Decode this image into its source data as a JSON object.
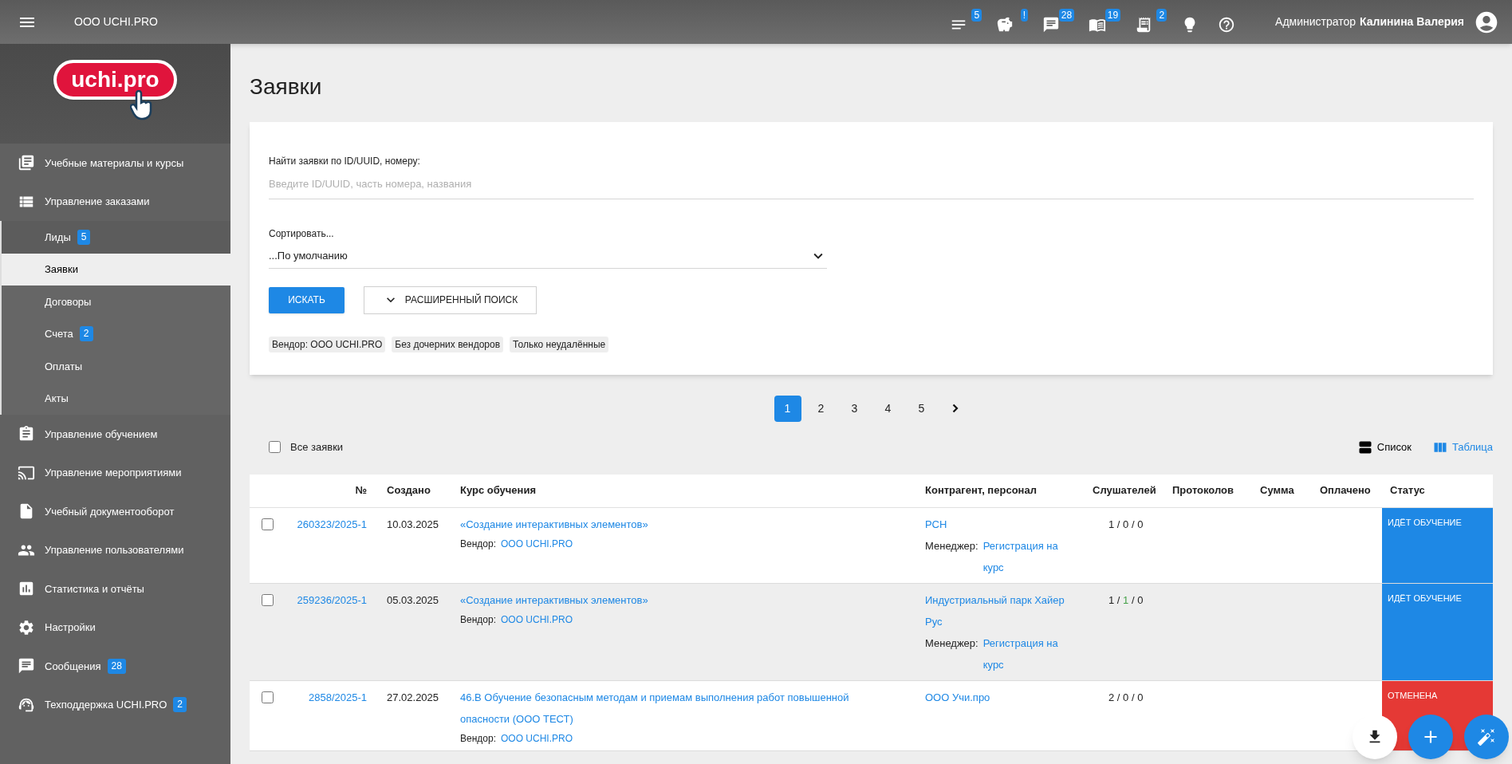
{
  "topbar": {
    "org": "ООО UCHI.PRO",
    "icons": [
      {
        "kind": "notes",
        "badge": "5"
      },
      {
        "kind": "piggy",
        "badge": "!"
      },
      {
        "kind": "chat",
        "badge": "28"
      },
      {
        "kind": "book",
        "badge": "19"
      },
      {
        "kind": "receipt",
        "badge": "2"
      },
      {
        "kind": "bulb"
      },
      {
        "kind": "help"
      }
    ],
    "user_role": "Администратор",
    "user_name": "Калинина Валерия"
  },
  "sidebar": {
    "logo": "uchi.pro",
    "items": [
      {
        "label": "Учебные материалы и курсы",
        "kind": "library",
        "selected": false
      },
      {
        "label": "Управление заказами",
        "kind": "list",
        "selected": false,
        "expanded": true,
        "children": [
          {
            "label": "Лиды",
            "badge": "5",
            "selected": false
          },
          {
            "label": "Заявки",
            "selected": true
          },
          {
            "label": "Договоры",
            "selected": false
          },
          {
            "label": "Счета",
            "badge": "2",
            "selected": false
          },
          {
            "label": "Оплаты",
            "selected": false
          },
          {
            "label": "Акты",
            "selected": false
          }
        ]
      },
      {
        "label": "Управление обучением",
        "kind": "clipboard",
        "selected": false
      },
      {
        "label": "Управление мероприятиями",
        "kind": "cast",
        "selected": false
      },
      {
        "label": "Учебный документооборот",
        "kind": "file",
        "selected": false
      },
      {
        "label": "Управление пользователями",
        "kind": "people",
        "selected": false
      },
      {
        "label": "Статистика и отчёты",
        "kind": "stats",
        "selected": false
      },
      {
        "label": "Настройки",
        "kind": "settings",
        "selected": false
      },
      {
        "label": "Сообщения",
        "kind": "chat",
        "badge": "28",
        "selected": false
      },
      {
        "label": "Техподдержка UCHI.PRO",
        "kind": "support",
        "badge": "2",
        "selected": false
      }
    ]
  },
  "page_title": "Заявки",
  "filter": {
    "search_label": "Найти заявки по ID/UUID, номеру:",
    "search_placeholder": "Введите ID/UUID, часть номера, названия",
    "sort_label": "Сортировать...",
    "sort_value": "...По умолчанию",
    "search_button": "ИСКАТЬ",
    "advanced_button": "РАСШИРЕННЫЙ ПОИСК",
    "chips": [
      "Вендор: ООО UCHI.PRO",
      "Без дочерних вендоров",
      "Только неудалённые"
    ]
  },
  "pagination": [
    {
      "label": "1",
      "selected": true
    },
    {
      "label": "2",
      "selected": false
    },
    {
      "label": "3",
      "selected": false
    },
    {
      "label": "4",
      "selected": false
    },
    {
      "label": "5",
      "selected": false
    }
  ],
  "select_all": {
    "label": "Все заявки",
    "checked": false
  },
  "views": [
    {
      "label": "Список",
      "kind": "list",
      "selected": false
    },
    {
      "label": "Таблица",
      "kind": "columns",
      "selected": true
    }
  ],
  "table": {
    "columns": [
      "№",
      "Создано",
      "Курс обучения",
      "Контрагент, персонал",
      "Слушателей",
      "Протоколов",
      "Сумма",
      "Оплачено",
      "Статус"
    ],
    "rows": [
      {
        "checked": false,
        "highlighted": false,
        "number": "260323/2025-1",
        "created": "10.03.2025",
        "course": "«Создание интерактивных элементов»",
        "vendor_label": "Вендор:",
        "vendor": "ООО UCHI.PRO",
        "contractor": "РСН",
        "manager_label": "Менеджер:",
        "manager": "Регистрация на курс",
        "listeners_separator": "/",
        "listeners": [
          {
            "value": "1",
            "highlight": false
          },
          {
            "value": "0",
            "highlight": false
          },
          {
            "value": "0",
            "highlight": false
          }
        ],
        "status": "ИДЁТ ОБУЧЕНИЕ",
        "kind": "learning"
      },
      {
        "checked": false,
        "highlighted": true,
        "number": "259236/2025-1",
        "created": "05.03.2025",
        "course": "«Создание интерактивных элементов»",
        "vendor_label": "Вендор:",
        "vendor": "ООО UCHI.PRO",
        "contractor": "Индустриальный парк Хайер Рус",
        "manager_label": "Менеджер:",
        "manager": "Регистрация на курс",
        "listeners_separator": "/",
        "listeners": [
          {
            "value": "1",
            "highlight": false
          },
          {
            "value": "1",
            "highlight": true
          },
          {
            "value": "0",
            "highlight": false
          }
        ],
        "status": "ИДЁТ ОБУЧЕНИЕ",
        "kind": "learning"
      },
      {
        "checked": false,
        "highlighted": false,
        "number": "2858/2025-1",
        "created": "27.02.2025",
        "course": "46.В Обучение безопасным методам и приемам выполнения работ повышенной опасности (ООО ТЕСТ)",
        "vendor_label": "Вендор:",
        "vendor": "ООО UCHI.PRO",
        "contractor": "ООО Учи.про",
        "listeners_separator": "/",
        "listeners": [
          {
            "value": "2",
            "highlight": false
          },
          {
            "value": "0",
            "highlight": false
          },
          {
            "value": "0",
            "highlight": false
          }
        ],
        "status": "ОТМЕНЕНА",
        "kind": "cancelled"
      }
    ]
  }
}
